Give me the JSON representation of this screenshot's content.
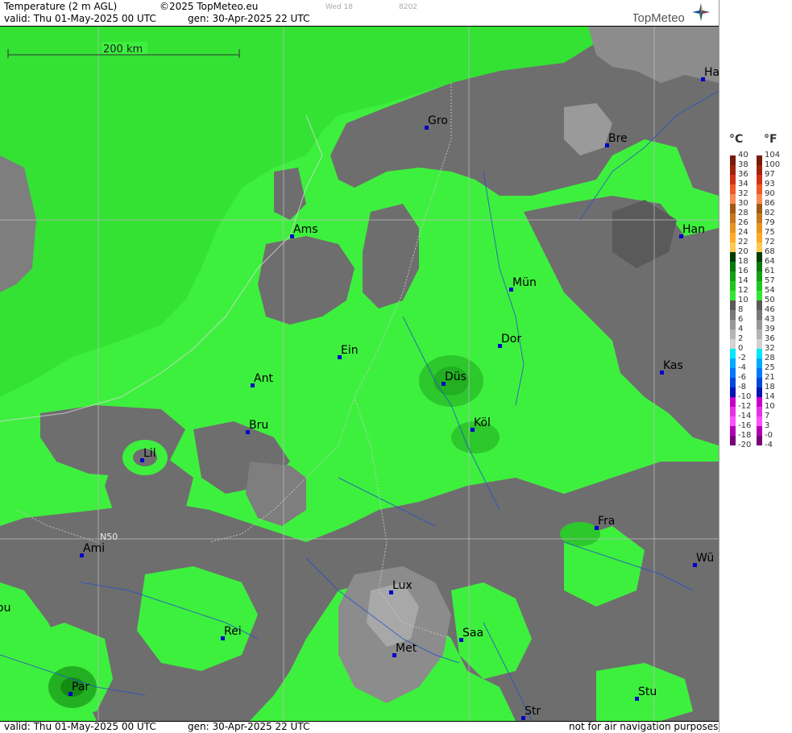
{
  "header": {
    "product": "Temperature (2 m AGL)",
    "copyright": "©2025 TopMeteo.eu",
    "faint_day": "Wed 18",
    "faint_code": "8202",
    "valid": "valid:  Thu  01-May-2025  00 UTC",
    "gen": "gen: 30-Apr-2025 22 UTC"
  },
  "logo": {
    "text": "TopMeteo",
    "icon": "compass-star-icon"
  },
  "footer": {
    "valid": "valid:  Thu  01-May-2025  00 UTC",
    "gen": "gen: 30-Apr-2025 22 UTC",
    "disclaimer": "not for air navigation purposes"
  },
  "map": {
    "scale_label": "200 km",
    "lat_label": "N50",
    "cities": [
      {
        "name": "Ha"
      },
      {
        "name": "Gro"
      },
      {
        "name": "Bre"
      },
      {
        "name": "Han"
      },
      {
        "name": "Ams"
      },
      {
        "name": "Mün"
      },
      {
        "name": "Dor"
      },
      {
        "name": "Ein"
      },
      {
        "name": "Kas"
      },
      {
        "name": "Düs"
      },
      {
        "name": "Ant"
      },
      {
        "name": "Köl"
      },
      {
        "name": "Bru"
      },
      {
        "name": "Lil"
      },
      {
        "name": "Fra"
      },
      {
        "name": "Ami"
      },
      {
        "name": "Wü"
      },
      {
        "name": "Lux"
      },
      {
        "name": "ou"
      },
      {
        "name": "Rei"
      },
      {
        "name": "Saa"
      },
      {
        "name": "Met"
      },
      {
        "name": "Par"
      },
      {
        "name": "Stu"
      },
      {
        "name": "Str"
      }
    ]
  },
  "legend": {
    "celsius_unit": "°C",
    "fahrenheit_unit": "°F",
    "celsius": [
      "40",
      "38",
      "36",
      "34",
      "32",
      "30",
      "28",
      "26",
      "24",
      "22",
      "20",
      "18",
      "16",
      "14",
      "12",
      "10",
      "8",
      "6",
      "4",
      "2",
      "0",
      "-2",
      "-4",
      "-6",
      "-8",
      "-10",
      "-12",
      "-14",
      "-16",
      "-18",
      "-20"
    ],
    "fahrenheit": [
      "104",
      "100",
      "97",
      "93",
      "90",
      "86",
      "82",
      "79",
      "75",
      "72",
      "68",
      "64",
      "61",
      "57",
      "54",
      "50",
      "46",
      "43",
      "39",
      "36",
      "32",
      "28",
      "25",
      "21",
      "18",
      "14",
      "10",
      "7",
      "3",
      "-0",
      "-4"
    ],
    "colors": [
      "#7a1a0a",
      "#a0220e",
      "#d23214",
      "#f05a28",
      "#f78a55",
      "#a05a14",
      "#c8781e",
      "#e6961e",
      "#ffaa28",
      "#ffc850",
      "#003c00",
      "#0a7a0a",
      "#14a014",
      "#1ec81e",
      "#32e632",
      "#5a5a5a",
      "#787878",
      "#969696",
      "#b4b4b4",
      "#d2d2d2",
      "#00e6ff",
      "#00aaff",
      "#0078ff",
      "#0046dc",
      "#0014b4",
      "#c800c8",
      "#e632e6",
      "#ff50ff",
      "#b400b4",
      "#780078"
    ]
  }
}
